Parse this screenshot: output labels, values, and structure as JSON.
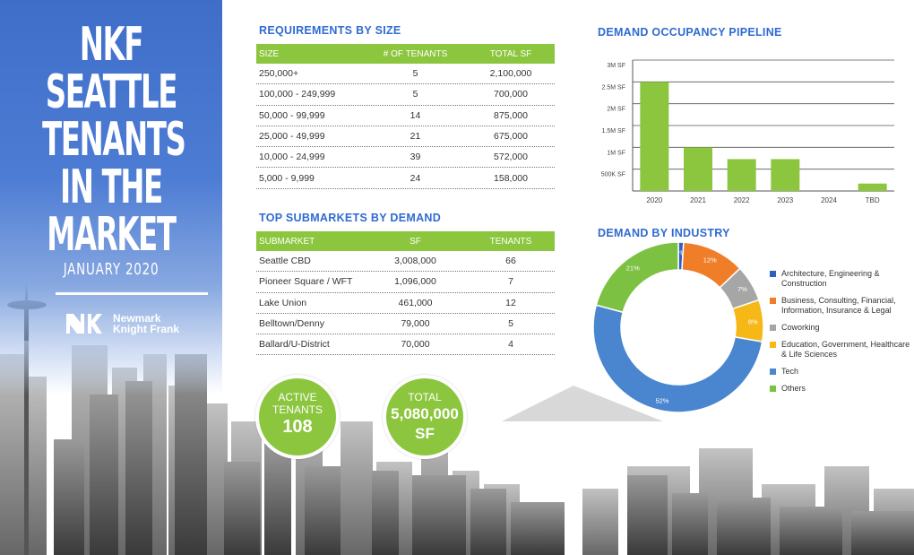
{
  "banner": {
    "title_lines": [
      "NKF",
      "SEATTLE",
      "TENANTS",
      "IN THE",
      "MARKET"
    ],
    "date": "JANUARY 2020",
    "logo_text_1": "Newmark",
    "logo_text_2": "Knight Frank",
    "bg_color": "#3f6ec9"
  },
  "requirements": {
    "title": "REQUIREMENTS BY SIZE",
    "headers": [
      "SIZE",
      "# OF TENANTS",
      "TOTAL SF"
    ],
    "rows": [
      [
        "250,000+",
        "5",
        "2,100,000"
      ],
      [
        "100,000 - 249,999",
        "5",
        "700,000"
      ],
      [
        "50,000 - 99,999",
        "14",
        "875,000"
      ],
      [
        "25,000 - 49,999",
        "21",
        "675,000"
      ],
      [
        "10,000 - 24,999",
        "39",
        "572,000"
      ],
      [
        "5,000 - 9,999",
        "24",
        "158,000"
      ]
    ]
  },
  "submarkets": {
    "title": "TOP SUBMARKETS BY DEMAND",
    "headers": [
      "SUBMARKET",
      "SF",
      "TENANTS"
    ],
    "rows": [
      [
        "Seattle CBD",
        "3,008,000",
        "66"
      ],
      [
        "Pioneer Square / WFT",
        "1,096,000",
        "7"
      ],
      [
        "Lake Union",
        "461,000",
        "12"
      ],
      [
        "Belltown/Denny",
        "79,000",
        "5"
      ],
      [
        "Ballard/U-District",
        "70,000",
        "4"
      ]
    ]
  },
  "stats": {
    "active_label_1": "ACTIVE",
    "active_label_2": "TENANTS",
    "active_value": "108",
    "total_label": "TOTAL",
    "total_value": "5,080,000",
    "total_unit": "SF"
  },
  "accent_color": "#8cc63f",
  "heading_color": "#2f6bd0",
  "chart_data": [
    {
      "type": "bar",
      "title": "DEMAND OCCUPANCY PIPELINE",
      "categories": [
        "2020",
        "2021",
        "2022",
        "2023",
        "2024",
        "TBD"
      ],
      "values": [
        2500000,
        1000000,
        730000,
        730000,
        0,
        170000
      ],
      "ylim": [
        0,
        3000000
      ],
      "yticks": [
        500000,
        1000000,
        1500000,
        2000000,
        2500000,
        3000000
      ],
      "ytick_labels": [
        "500K SF",
        "1M SF",
        "1.5M SF",
        "2M SF",
        "2.5M SF",
        "3M SF"
      ],
      "grid": true,
      "color": "#8cc63f"
    },
    {
      "type": "pie",
      "title": "DEMAND BY INDUSTRY",
      "series": [
        {
          "name": "Architecture, Engineering & Construction",
          "value": 1,
          "label": "1%",
          "color": "#2f5fbf"
        },
        {
          "name": "Business, Consulting, Financial, Information, Insurance & Legal",
          "value": 12,
          "label": "12%",
          "color": "#f07d28"
        },
        {
          "name": "Coworking",
          "value": 7,
          "label": "7%",
          "color": "#a6a6a6"
        },
        {
          "name": "Education, Government, Healthcare & Life Sciences",
          "value": 8,
          "label": "8%",
          "color": "#f5b816"
        },
        {
          "name": "Tech",
          "value": 52,
          "label": "52%",
          "color": "#4a86d0"
        },
        {
          "name": "Others",
          "value": 21,
          "label": "21%",
          "color": "#7cc142"
        }
      ],
      "legend_position": "right"
    }
  ]
}
